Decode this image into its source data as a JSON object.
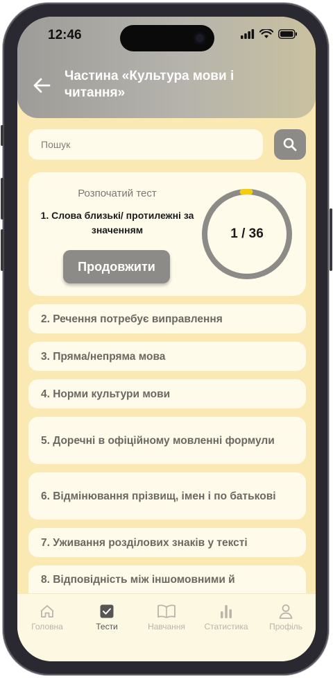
{
  "status": {
    "time": "12:46"
  },
  "header": {
    "title": "Частина «Культура мови і читання»"
  },
  "search": {
    "placeholder": "Пошук"
  },
  "current": {
    "label": "Розпочатий тест",
    "test": "1.  Слова близькі/ протилежні за значенням",
    "button": "Продовжити",
    "progress_text": "1 / 36",
    "progress_fraction": 0.028
  },
  "tests": [
    {
      "label": "2. Речення потребує виправлення"
    },
    {
      "label": "3. Пряма/непряма мова"
    },
    {
      "label": "4. Норми культури мови"
    },
    {
      "label": "5. Доречні в офіційному мовленні формули"
    },
    {
      "label": "6. Відмінювання прізвищ, імен і по батькові"
    },
    {
      "label": "7. Уживання розділових знаків у тексті"
    },
    {
      "label": "8. Відповідність між іншомовними й"
    }
  ],
  "tabs": [
    {
      "label": "Головна",
      "icon": "home-icon"
    },
    {
      "label": "Тести",
      "icon": "checkbox-icon"
    },
    {
      "label": "Навчання",
      "icon": "book-icon"
    },
    {
      "label": "Статистика",
      "icon": "chart-icon"
    },
    {
      "label": "Профіль",
      "icon": "profile-icon"
    }
  ],
  "colors": {
    "background": "#fbe9b4",
    "card": "#fffbea",
    "accent": "#8d8b88",
    "progress": "#f2cf0a"
  }
}
